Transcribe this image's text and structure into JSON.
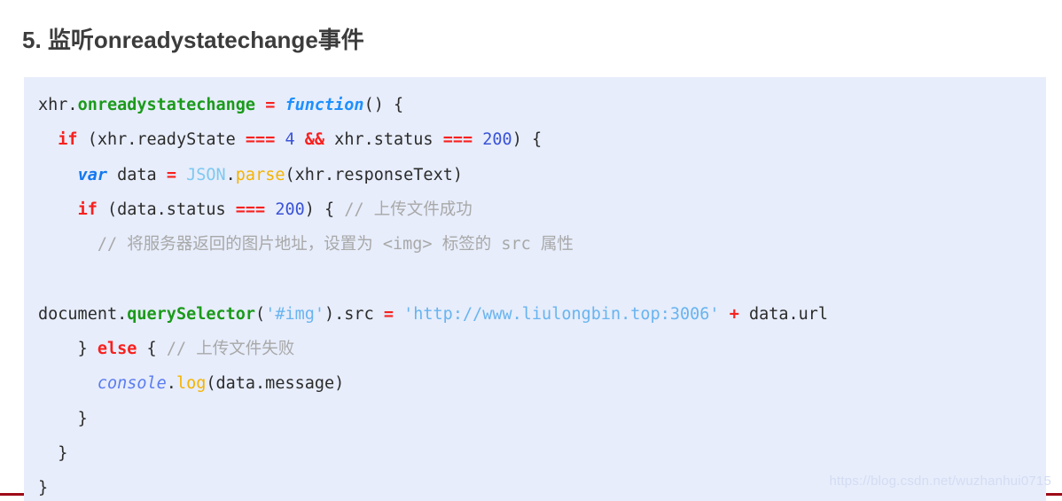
{
  "heading": "5. 监听onreadystatechange事件",
  "watermark": "https://blog.csdn.net/wuzhanhui0715",
  "colors": {
    "code_background": "#e7edfb",
    "page_background": "#ffffff",
    "heading": "#3c3c3c",
    "property": "#1a9a1a",
    "keyword": "#f8201e",
    "var_keyword": "#1478f0",
    "function_keyword": "#1e90ff",
    "operator": "#f8201e",
    "number": "#3a53d8",
    "class_name": "#7ec8f0",
    "method": "#f5b301",
    "string": "#68b4f0",
    "comment": "#a8a8a8",
    "watermark": "#d3dcf2",
    "accent": "#9e0a17"
  },
  "code": {
    "language": "javascript",
    "lines": [
      {
        "indent": 0,
        "tokens": [
          {
            "t": "xhr",
            "k": "plain"
          },
          {
            "t": ".",
            "k": "plain"
          },
          {
            "t": "onreadystatechange",
            "k": "prop"
          },
          {
            "t": " ",
            "k": "plain"
          },
          {
            "t": "=",
            "k": "op"
          },
          {
            "t": " ",
            "k": "plain"
          },
          {
            "t": "function",
            "k": "func"
          },
          {
            "t": "() {",
            "k": "plain"
          }
        ]
      },
      {
        "indent": 1,
        "tokens": [
          {
            "t": "if",
            "k": "keyword"
          },
          {
            "t": " (xhr.readyState ",
            "k": "plain"
          },
          {
            "t": "===",
            "k": "op"
          },
          {
            "t": " ",
            "k": "plain"
          },
          {
            "t": "4",
            "k": "num"
          },
          {
            "t": " ",
            "k": "plain"
          },
          {
            "t": "&&",
            "k": "op"
          },
          {
            "t": " xhr.status ",
            "k": "plain"
          },
          {
            "t": "===",
            "k": "op"
          },
          {
            "t": " ",
            "k": "plain"
          },
          {
            "t": "200",
            "k": "num"
          },
          {
            "t": ") {",
            "k": "plain"
          }
        ]
      },
      {
        "indent": 2,
        "tokens": [
          {
            "t": "var",
            "k": "kw-var"
          },
          {
            "t": " data ",
            "k": "plain"
          },
          {
            "t": "=",
            "k": "op"
          },
          {
            "t": " ",
            "k": "plain"
          },
          {
            "t": "JSON",
            "k": "class"
          },
          {
            "t": ".",
            "k": "plain"
          },
          {
            "t": "parse",
            "k": "method"
          },
          {
            "t": "(xhr.responseText)",
            "k": "plain"
          }
        ]
      },
      {
        "indent": 2,
        "tokens": [
          {
            "t": "if",
            "k": "keyword"
          },
          {
            "t": " (data.status ",
            "k": "plain"
          },
          {
            "t": "===",
            "k": "op"
          },
          {
            "t": " ",
            "k": "plain"
          },
          {
            "t": "200",
            "k": "num"
          },
          {
            "t": ") { ",
            "k": "plain"
          },
          {
            "t": "// 上传文件成功",
            "k": "comment"
          }
        ]
      },
      {
        "indent": 3,
        "tokens": [
          {
            "t": "// 将服务器返回的图片地址，设置为 <img> 标签的 src 属性",
            "k": "comment"
          }
        ]
      },
      {
        "indent": 0,
        "tokens": []
      },
      {
        "indent": 0,
        "tokens": [
          {
            "t": "document",
            "k": "plain"
          },
          {
            "t": ".",
            "k": "plain"
          },
          {
            "t": "querySelector",
            "k": "prop"
          },
          {
            "t": "(",
            "k": "plain"
          },
          {
            "t": "'#img'",
            "k": "string"
          },
          {
            "t": ").src ",
            "k": "plain"
          },
          {
            "t": "=",
            "k": "op"
          },
          {
            "t": " ",
            "k": "plain"
          },
          {
            "t": "'http://www.liulongbin.top:3006'",
            "k": "string"
          },
          {
            "t": " ",
            "k": "plain"
          },
          {
            "t": "+",
            "k": "op"
          },
          {
            "t": " data.url",
            "k": "plain"
          }
        ]
      },
      {
        "indent": 2,
        "tokens": [
          {
            "t": "} ",
            "k": "plain"
          },
          {
            "t": "else",
            "k": "keyword"
          },
          {
            "t": " { ",
            "k": "plain"
          },
          {
            "t": "// 上传文件失败",
            "k": "comment"
          }
        ]
      },
      {
        "indent": 3,
        "tokens": [
          {
            "t": "console",
            "k": "console"
          },
          {
            "t": ".",
            "k": "plain"
          },
          {
            "t": "log",
            "k": "method"
          },
          {
            "t": "(data.message)",
            "k": "plain"
          }
        ]
      },
      {
        "indent": 2,
        "tokens": [
          {
            "t": "}",
            "k": "plain"
          }
        ]
      },
      {
        "indent": 1,
        "tokens": [
          {
            "t": "}",
            "k": "plain"
          }
        ]
      },
      {
        "indent": 0,
        "tokens": [
          {
            "t": "}",
            "k": "plain"
          }
        ]
      }
    ]
  }
}
